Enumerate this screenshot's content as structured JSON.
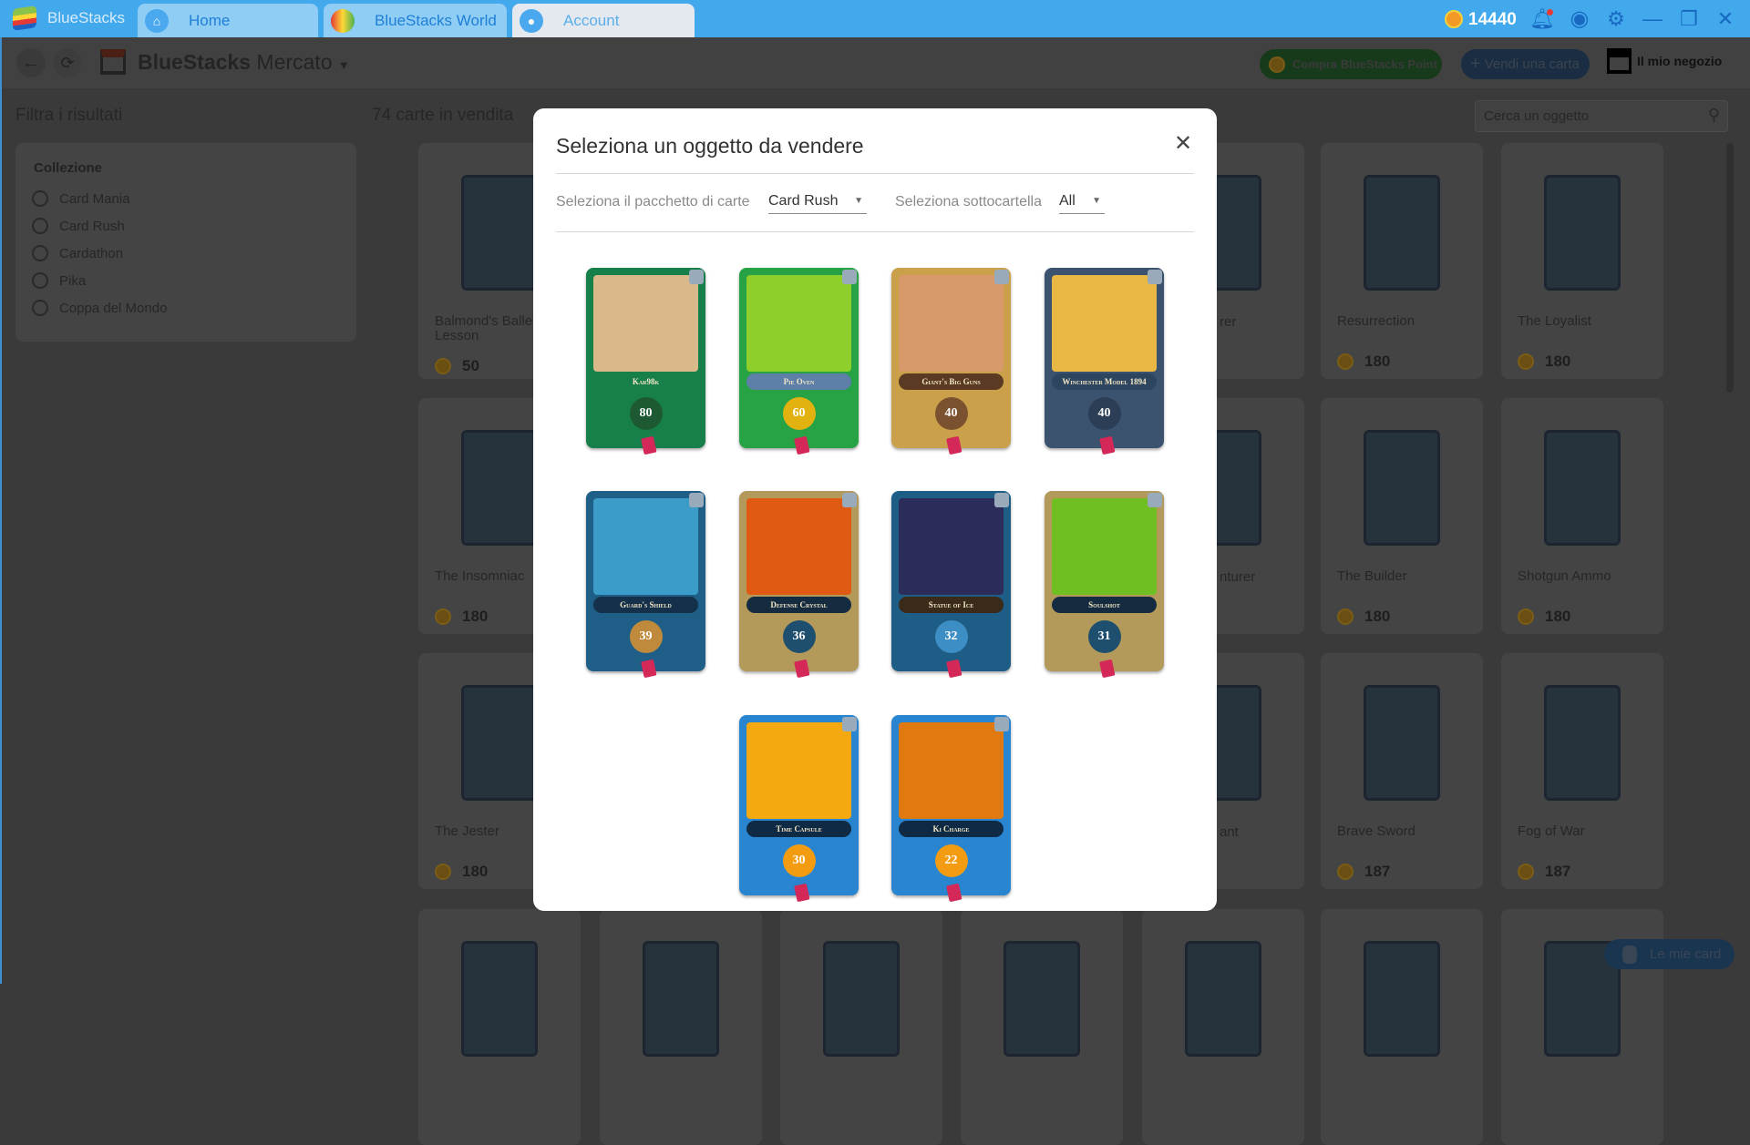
{
  "titlebar": {
    "app_name": "BlueStacks",
    "tabs": [
      {
        "label": "Home",
        "icon": "home-icon"
      },
      {
        "label": "BlueStacks World",
        "icon": "globe-icon"
      },
      {
        "label": "Account",
        "icon": "account-icon"
      }
    ],
    "points": "14440"
  },
  "toolbar": {
    "title_bold": "BlueStacks",
    "title_light": "Mercato",
    "buy_points": "Compra BlueStacks Point",
    "sell_card": "Vendi una carta",
    "my_shop": "Il mio negozio"
  },
  "filters": {
    "heading": "Filtra i risultati",
    "section": "Collezione",
    "options": [
      "Card Mania",
      "Card Rush",
      "Cardathon",
      "Pika",
      "Coppa del Mondo"
    ]
  },
  "market": {
    "count": "74 carte in vendita",
    "search_placeholder": "Cerca un oggetto",
    "my_cards": "Le mie card",
    "cards": [
      {
        "name": "Balmond's Ballet Lesson",
        "price": "50"
      },
      {
        "name": "Resurrection",
        "price": "180"
      },
      {
        "name": "The Loyalist",
        "price": "180"
      },
      {
        "name": "The Insomniac",
        "price": "180"
      },
      {
        "name": "The Builder",
        "price": "180"
      },
      {
        "name": "Shotgun Ammo",
        "price": "180"
      },
      {
        "name": "The Jester",
        "price": "180"
      },
      {
        "name": "Brave Sword",
        "price": "187"
      },
      {
        "name": "Fog of War",
        "price": "187"
      }
    ],
    "partial_names": [
      "rer",
      "nturer",
      "ant"
    ]
  },
  "modal": {
    "title": "Seleziona un oggetto da vendere",
    "pack_label": "Seleziona il pacchetto di carte",
    "pack_value": "Card Rush",
    "sub_label": "Seleziona sottocartella",
    "sub_value": "All",
    "cards": [
      {
        "name": "Kar98k",
        "value": "80",
        "frame": "#17804a",
        "art": "#d9b98a",
        "banner": "#17804a",
        "badge": "#1d5a33"
      },
      {
        "name": "Pie Oven",
        "value": "60",
        "frame": "#27a244",
        "art": "#8fcf2c",
        "banner": "#5d7fa8",
        "badge": "#e2b211"
      },
      {
        "name": "Giant's Big Guns",
        "value": "40",
        "frame": "#caa04a",
        "art": "#d89a6a",
        "banner": "#5a3a22",
        "badge": "#7a5230"
      },
      {
        "name": "Winchester Model 1894",
        "value": "40",
        "frame": "#3c5370",
        "art": "#e9b844",
        "banner": "#2e4560",
        "badge": "#2c3e55"
      },
      {
        "name": "Guard's Shield",
        "value": "39",
        "frame": "#1f5f87",
        "art": "#3a9cc7",
        "banner": "#15304a",
        "badge": "#c08a3c"
      },
      {
        "name": "Defense Crystal",
        "value": "36",
        "frame": "#b49a5a",
        "art": "#e05a14",
        "banner": "#152c40",
        "badge": "#1e4f6e"
      },
      {
        "name": "Statue of Ice",
        "value": "32",
        "frame": "#1d5d86",
        "art": "#2b2c5a",
        "banner": "#3a2a1a",
        "badge": "#3d8ec4"
      },
      {
        "name": "Soulshot",
        "value": "31",
        "frame": "#b49a5a",
        "art": "#6fbf22",
        "banner": "#152c40",
        "badge": "#1e4f6e"
      },
      {
        "name": "Time Capsule",
        "value": "30",
        "frame": "#2a85d0",
        "art": "#f5a910",
        "banner": "#0e2a45",
        "badge": "#f39c12"
      },
      {
        "name": "Ki Charge",
        "value": "22",
        "frame": "#2a85d0",
        "art": "#e07a10",
        "banner": "#0e2a45",
        "badge": "#f39c12"
      }
    ]
  }
}
